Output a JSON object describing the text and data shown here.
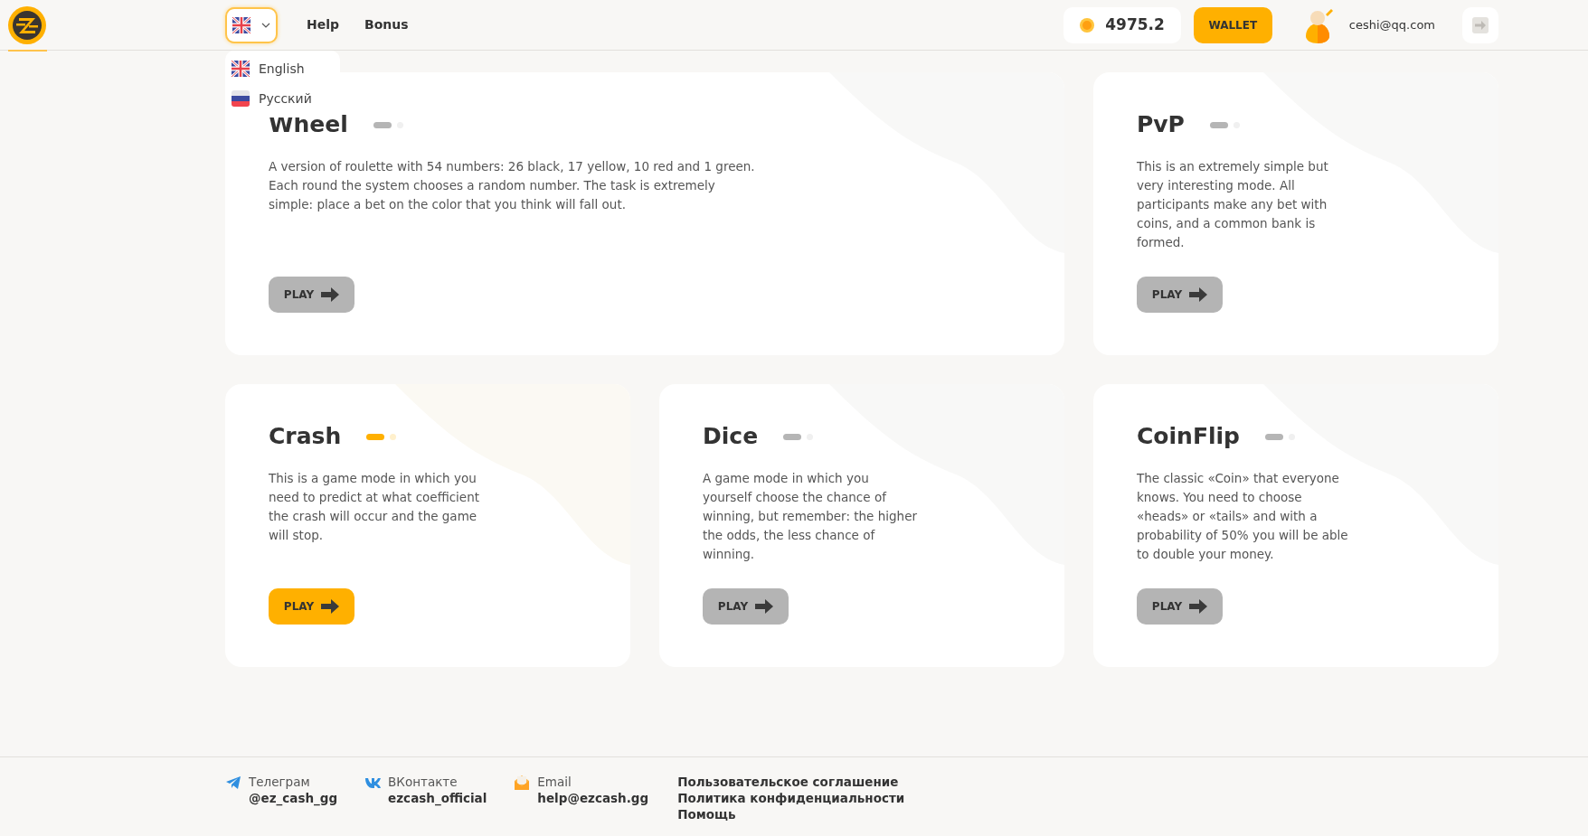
{
  "header": {
    "nav": [
      "Help",
      "Bonus"
    ],
    "balance": "4975.2",
    "wallet_button": "WALLET",
    "user_email": "ceshi@qq.com"
  },
  "language_menu": {
    "expanded": true,
    "items": [
      {
        "kind": "uk",
        "label": "English"
      },
      {
        "kind": "ru",
        "label": "Русский"
      }
    ]
  },
  "game_rows": [
    [
      {
        "title": "Wheel",
        "active": false,
        "description": "A version of roulette with 54 numbers: 26 black, 17 yellow, 10 red and 1 green. Each round the system chooses a random number. The task is extremely simple: place a bet on the color that you think will fall out.",
        "button": "PLAY"
      },
      {
        "title": "PvP",
        "active": false,
        "description": "This is an extremely simple but very interesting mode. All participants make any bet with coins, and a common bank is formed.",
        "button": "PLAY"
      }
    ],
    [
      {
        "title": "Crash",
        "active": true,
        "description": "This is a game mode in which you need to predict at what coefficient the crash will occur and the game will stop.",
        "button": "PLAY"
      },
      {
        "title": "Dice",
        "active": false,
        "description": "A game mode in which you yourself choose the chance of winning, but remember: the higher the odds, the less chance of winning.",
        "button": "PLAY"
      },
      {
        "title": "CoinFlip",
        "active": false,
        "description": "The classic «Coin» that everyone knows. You need to choose «heads» or «tails» and with a probability of 50% you will be able to double your money.",
        "button": "PLAY"
      }
    ]
  ],
  "footer": {
    "contacts": [
      {
        "kind": "telegram",
        "label": "Телеграм",
        "value": "@ez_cash_gg"
      },
      {
        "kind": "vk",
        "label": "ВКонтакте",
        "value": "ezcash_official"
      },
      {
        "kind": "email",
        "label": "Email",
        "value": "help@ezcash.gg"
      }
    ],
    "links": [
      "Пользовательское соглашение",
      "Политика конфиденциальности",
      "Помощь"
    ]
  }
}
